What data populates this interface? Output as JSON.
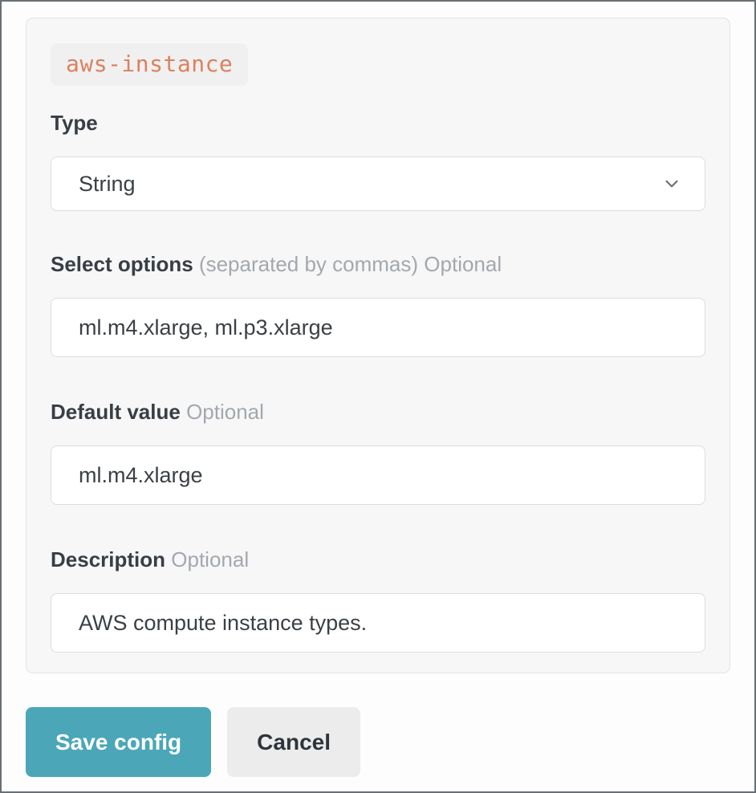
{
  "config": {
    "name_tag": "aws-instance",
    "fields": {
      "type": {
        "label": "Type",
        "value": "String"
      },
      "select_options": {
        "label": "Select options",
        "hint": "(separated by commas)",
        "optional": "Optional",
        "value": "ml.m4.xlarge, ml.p3.xlarge"
      },
      "default_value": {
        "label": "Default value",
        "optional": "Optional",
        "value": "ml.m4.xlarge"
      },
      "description": {
        "label": "Description",
        "optional": "Optional",
        "value": "AWS compute instance types."
      }
    }
  },
  "actions": {
    "save_label": "Save config",
    "cancel_label": "Cancel"
  },
  "icons": {
    "chevron_down": "chevron-down"
  },
  "colors": {
    "accent_teal": "#4ba7b8",
    "tag_orange": "#d9825f",
    "label_dark": "#383e44",
    "muted_gray": "#a3a8ad",
    "card_bg": "#f7f7f8",
    "input_border": "#dcdddf"
  }
}
